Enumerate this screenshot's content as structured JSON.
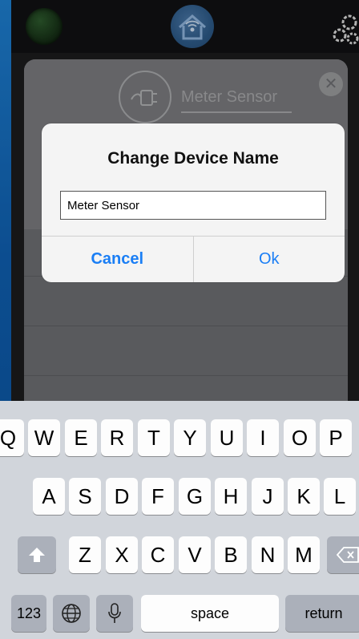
{
  "device_panel": {
    "title": "Meter Sensor",
    "close_glyph": "✕",
    "icon": "plug-icon"
  },
  "dialog": {
    "title": "Change Device Name",
    "input_value": "Meter Sensor",
    "cancel_label": "Cancel",
    "ok_label": "Ok",
    "accent_color": "#1a7ef5"
  },
  "keyboard": {
    "row1": [
      "Q",
      "W",
      "E",
      "R",
      "T",
      "Y",
      "U",
      "I",
      "O",
      "P"
    ],
    "row2": [
      "A",
      "S",
      "D",
      "F",
      "G",
      "H",
      "J",
      "K",
      "L"
    ],
    "row3": [
      "Z",
      "X",
      "C",
      "V",
      "B",
      "N",
      "M"
    ],
    "numbers_label": "123",
    "space_label": "space",
    "return_label": "return",
    "icons": [
      "shift-icon",
      "backspace-icon",
      "globe-icon",
      "microphone-icon"
    ]
  },
  "topbar": {
    "icons": [
      "status-indicator",
      "home-logo-icon",
      "settings-gears-icon"
    ]
  }
}
